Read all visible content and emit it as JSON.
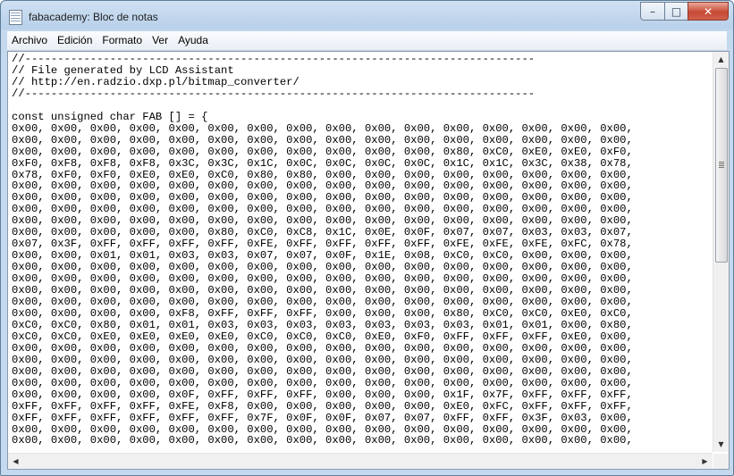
{
  "window": {
    "title": "fabacademy: Bloc de notas"
  },
  "caption_buttons": {
    "minimize": "–",
    "maximize": "□",
    "close": "✕"
  },
  "menu": [
    {
      "label": "Archivo"
    },
    {
      "label": "Edición"
    },
    {
      "label": "Formato"
    },
    {
      "label": "Ver"
    },
    {
      "label": "Ayuda"
    }
  ],
  "document": {
    "lines": [
      "//------------------------------------------------------------------------------",
      "// File generated by LCD Assistant",
      "// http://en.radzio.dxp.pl/bitmap_converter/",
      "//------------------------------------------------------------------------------",
      "",
      "const unsigned char FAB [] = {",
      "0x00, 0x00, 0x00, 0x00, 0x00, 0x00, 0x00, 0x00, 0x00, 0x00, 0x00, 0x00, 0x00, 0x00, 0x00, 0x00,",
      "0x00, 0x00, 0x00, 0x00, 0x00, 0x00, 0x00, 0x00, 0x00, 0x00, 0x00, 0x00, 0x00, 0x00, 0x00, 0x00,",
      "0x00, 0x00, 0x00, 0x00, 0x00, 0x00, 0x00, 0x00, 0x00, 0x00, 0x00, 0x80, 0xC0, 0xE0, 0xE0, 0xF0,",
      "0xF0, 0xF8, 0xF8, 0xF8, 0x3C, 0x3C, 0x1C, 0x0C, 0x0C, 0x0C, 0x0C, 0x1C, 0x1C, 0x3C, 0x38, 0x78,",
      "0x78, 0xF0, 0xF0, 0xE0, 0xE0, 0xC0, 0x80, 0x80, 0x00, 0x00, 0x00, 0x00, 0x00, 0x00, 0x00, 0x00,",
      "0x00, 0x00, 0x00, 0x00, 0x00, 0x00, 0x00, 0x00, 0x00, 0x00, 0x00, 0x00, 0x00, 0x00, 0x00, 0x00,",
      "0x00, 0x00, 0x00, 0x00, 0x00, 0x00, 0x00, 0x00, 0x00, 0x00, 0x00, 0x00, 0x00, 0x00, 0x00, 0x00,",
      "0x00, 0x00, 0x00, 0x00, 0x00, 0x00, 0x00, 0x00, 0x00, 0x00, 0x00, 0x00, 0x00, 0x00, 0x00, 0x00,",
      "0x00, 0x00, 0x00, 0x00, 0x00, 0x00, 0x00, 0x00, 0x00, 0x00, 0x00, 0x00, 0x00, 0x00, 0x00, 0x00,",
      "0x00, 0x00, 0x00, 0x00, 0x00, 0x80, 0xC0, 0xC8, 0x1C, 0x0E, 0x0F, 0x07, 0x07, 0x03, 0x03, 0x07,",
      "0x07, 0x3F, 0xFF, 0xFF, 0xFF, 0xFF, 0xFE, 0xFF, 0xFF, 0xFF, 0xFF, 0xFE, 0xFE, 0xFE, 0xFC, 0x78,",
      "0x00, 0x00, 0x01, 0x01, 0x03, 0x03, 0x07, 0x07, 0x0F, 0x1E, 0x08, 0xC0, 0xC0, 0x00, 0x00, 0x00,",
      "0x00, 0x00, 0x00, 0x00, 0x00, 0x00, 0x00, 0x00, 0x00, 0x00, 0x00, 0x00, 0x00, 0x00, 0x00, 0x00,",
      "0x00, 0x00, 0x00, 0x00, 0x00, 0x00, 0x00, 0x00, 0x00, 0x00, 0x00, 0x00, 0x00, 0x00, 0x00, 0x00,",
      "0x00, 0x00, 0x00, 0x00, 0x00, 0x00, 0x00, 0x00, 0x00, 0x00, 0x00, 0x00, 0x00, 0x00, 0x00, 0x00,",
      "0x00, 0x00, 0x00, 0x00, 0x00, 0x00, 0x00, 0x00, 0x00, 0x00, 0x00, 0x00, 0x00, 0x00, 0x00, 0x00,",
      "0x00, 0x00, 0x00, 0x00, 0xF8, 0xFF, 0xFF, 0xFF, 0x00, 0x00, 0x00, 0x80, 0xC0, 0xC0, 0xE0, 0xC0,",
      "0xC0, 0xC0, 0x80, 0x01, 0x01, 0x03, 0x03, 0x03, 0x03, 0x03, 0x03, 0x03, 0x01, 0x01, 0x00, 0x80,",
      "0xC0, 0xC0, 0xE0, 0xE0, 0xE0, 0xE0, 0xC0, 0xC0, 0xC0, 0xE0, 0xF0, 0xFF, 0xFF, 0xFF, 0xE0, 0x00,",
      "0x00, 0x00, 0x00, 0x00, 0x00, 0x00, 0x00, 0x00, 0x00, 0x00, 0x00, 0x00, 0x00, 0x00, 0x00, 0x00,",
      "0x00, 0x00, 0x00, 0x00, 0x00, 0x00, 0x00, 0x00, 0x00, 0x00, 0x00, 0x00, 0x00, 0x00, 0x00, 0x00,",
      "0x00, 0x00, 0x00, 0x00, 0x00, 0x00, 0x00, 0x00, 0x00, 0x00, 0x00, 0x00, 0x00, 0x00, 0x00, 0x00,",
      "0x00, 0x00, 0x00, 0x00, 0x00, 0x00, 0x00, 0x00, 0x00, 0x00, 0x00, 0x00, 0x00, 0x00, 0x00, 0x00,",
      "0x00, 0x00, 0x00, 0x00, 0x0F, 0xFF, 0xFF, 0xFF, 0x00, 0x00, 0x00, 0x1F, 0x7F, 0xFF, 0xFF, 0xFF,",
      "0xFF, 0xFF, 0xFF, 0xFF, 0xFE, 0xF8, 0x00, 0x00, 0x00, 0x00, 0x00, 0xE0, 0xFC, 0xFF, 0xFF, 0xFF,",
      "0xFF, 0xFF, 0xFF, 0xFF, 0xFF, 0xFF, 0x7F, 0x0F, 0x0F, 0x07, 0x07, 0xFF, 0xFF, 0x3F, 0x03, 0x00,",
      "0x00, 0x00, 0x00, 0x00, 0x00, 0x00, 0x00, 0x00, 0x00, 0x00, 0x00, 0x00, 0x00, 0x00, 0x00, 0x00,",
      "0x00, 0x00, 0x00, 0x00, 0x00, 0x00, 0x00, 0x00, 0x00, 0x00, 0x00, 0x00, 0x00, 0x00, 0x00, 0x00,"
    ]
  },
  "scrollbars": {
    "vertical_position": 0.0,
    "horizontal_position": 0.0
  }
}
